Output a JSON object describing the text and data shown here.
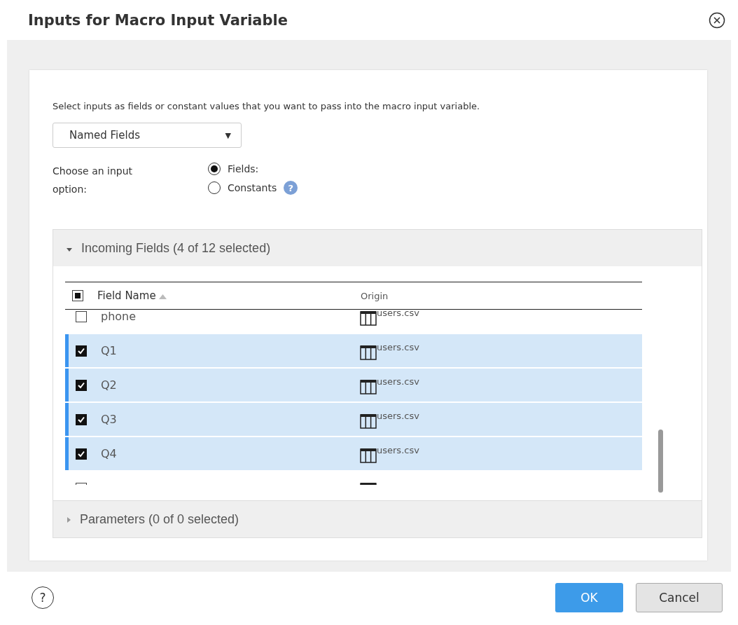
{
  "dialog": {
    "title": "Inputs for Macro Input Variable"
  },
  "description": "Select inputs as fields or constant values that you want to pass into the macro input variable.",
  "dropdown": {
    "value": "Named Fields",
    "caret": "▼"
  },
  "input_option": {
    "label": "Choose an input option:",
    "options": [
      {
        "label": "Fields:",
        "selected": true
      },
      {
        "label": "Constants",
        "selected": false,
        "help": "?"
      }
    ]
  },
  "sections": [
    {
      "title": "Incoming Fields (4 of 12 selected)",
      "expanded": true,
      "table": {
        "all_selected": false,
        "partially_selected": true,
        "columns": [
          {
            "label": "Field Name",
            "sorted": true
          },
          {
            "label": "Origin",
            "sorted": false
          }
        ],
        "rows": [
          {
            "field_name": "phone",
            "origin": "users.csv",
            "checked": false
          },
          {
            "field_name": "Q1",
            "origin": "users.csv",
            "checked": true
          },
          {
            "field_name": "Q2",
            "origin": "users.csv",
            "checked": true
          },
          {
            "field_name": "Q3",
            "origin": "users.csv",
            "checked": true
          },
          {
            "field_name": "Q4",
            "origin": "users.csv",
            "checked": true
          },
          {
            "checked": false
          }
        ]
      }
    },
    {
      "title": "Parameters (0 of 0 selected)",
      "expanded": false
    }
  ],
  "help_button": "?",
  "buttons": [
    {
      "label": "OK",
      "kind": "primary"
    },
    {
      "label": "Cancel",
      "kind": "secondary"
    }
  ]
}
